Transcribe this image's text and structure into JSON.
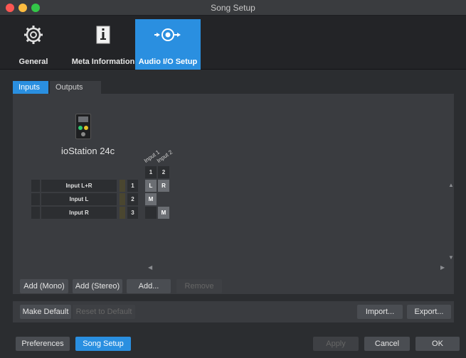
{
  "window": {
    "title": "Song Setup"
  },
  "top_tabs": [
    {
      "label": "General",
      "icon": "gear-icon"
    },
    {
      "label": "Meta Information",
      "icon": "info-document-icon"
    },
    {
      "label": "Audio I/O Setup",
      "icon": "audio-io-icon",
      "selected": true
    }
  ],
  "sub_tabs": [
    {
      "label": "Inputs",
      "selected": true
    },
    {
      "label": "Outputs"
    }
  ],
  "device": {
    "name": "ioStation 24c",
    "icon": "audio-interface-icon"
  },
  "matrix": {
    "columns": [
      "Input 1",
      "Input 2"
    ],
    "column_numbers": [
      "1",
      "2"
    ],
    "rows": [
      {
        "name": "Input L+R",
        "number": "1",
        "cells": [
          "L",
          "R"
        ]
      },
      {
        "name": "Input L",
        "number": "2",
        "cells": [
          "M",
          ""
        ]
      },
      {
        "name": "Input R",
        "number": "3",
        "cells": [
          "",
          "M"
        ]
      }
    ]
  },
  "buttons": {
    "add_mono": "Add (Mono)",
    "add_stereo": "Add (Stereo)",
    "add": "Add...",
    "remove": "Remove",
    "make_default": "Make Default",
    "reset_default": "Reset to Default",
    "import": "Import...",
    "export": "Export...",
    "preferences": "Preferences",
    "song_setup": "Song Setup",
    "apply": "Apply",
    "cancel": "Cancel",
    "ok": "OK"
  },
  "colors": {
    "accent": "#2a8fe0",
    "background": "#2b2d30"
  }
}
